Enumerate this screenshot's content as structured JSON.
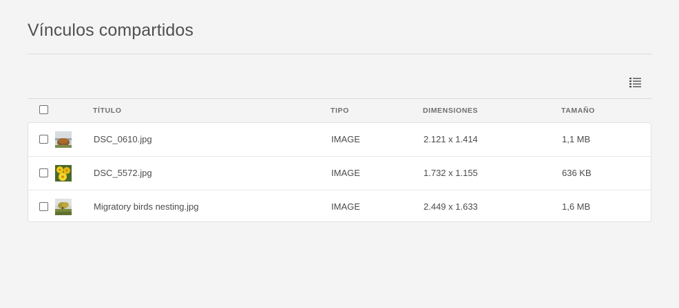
{
  "page": {
    "title": "Vínculos compartidos"
  },
  "toolbar": {
    "view_toggle_icon": "list-view-icon"
  },
  "table": {
    "select_all_icon": "checkbox-icon",
    "columns": {
      "title": "Título",
      "type": "Tipo",
      "dimensions": "Dimensiones",
      "size": "Tamaño"
    },
    "rows": [
      {
        "title": "DSC_0610.jpg",
        "type": "IMAGE",
        "dimensions": "2.121 x 1.414",
        "size": "1,1 MB",
        "thumbnail_icon": "landscape-thumbnail"
      },
      {
        "title": "DSC_5572.jpg",
        "type": "IMAGE",
        "dimensions": "1.732 x 1.155",
        "size": "636 KB",
        "thumbnail_icon": "yellow-flowers-thumbnail"
      },
      {
        "title": "Migratory birds nesting.jpg",
        "type": "IMAGE",
        "dimensions": "2.449 x 1.633",
        "size": "1,6 MB",
        "thumbnail_icon": "field-tree-thumbnail"
      }
    ]
  },
  "colors": {
    "background": "#f4f4f4",
    "text": "#4b4b4b",
    "header_text": "#6e6e6e",
    "rule": "#dcdcdc"
  }
}
